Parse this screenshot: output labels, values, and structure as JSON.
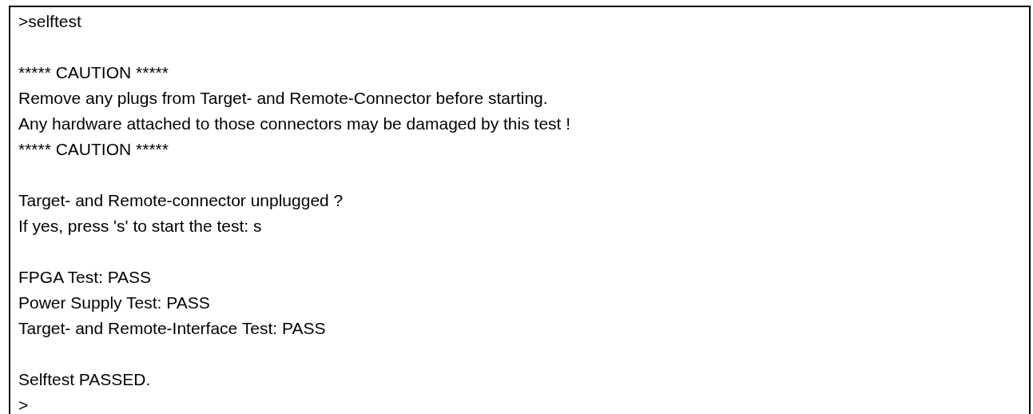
{
  "console": {
    "blocks": [
      {
        "lines": [
          ">selftest"
        ]
      },
      {
        "lines": [
          "***** CAUTION *****",
          "Remove any plugs from Target- and Remote-Connector before starting.",
          "Any hardware attached to those connectors may be damaged by this test !",
          "***** CAUTION *****"
        ]
      },
      {
        "lines": [
          "Target- and Remote-connector unplugged ?",
          "If yes, press 's' to start the test: s"
        ]
      },
      {
        "lines": [
          "FPGA Test: PASS",
          "Power Supply Test: PASS",
          "Target- and Remote-Interface Test: PASS"
        ]
      },
      {
        "lines": [
          "Selftest PASSED.",
          ">"
        ]
      }
    ]
  }
}
